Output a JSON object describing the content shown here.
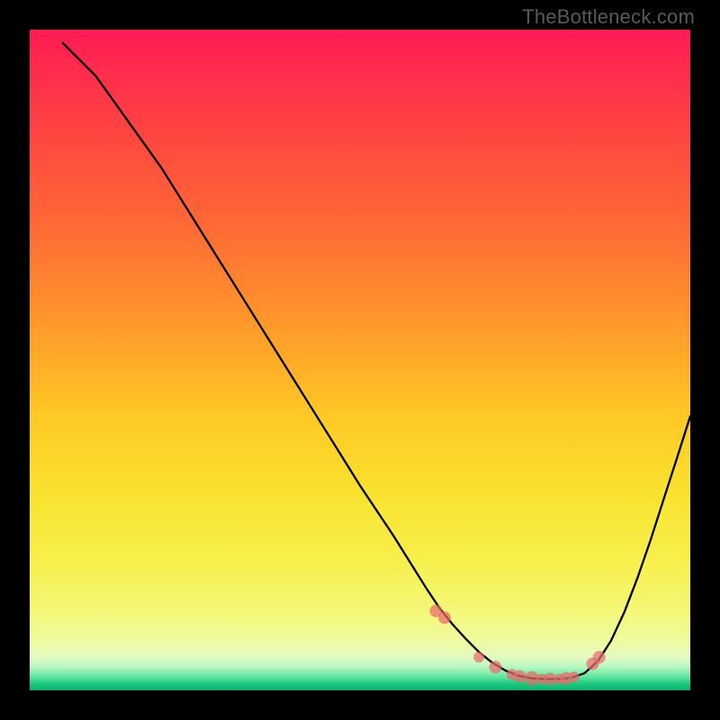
{
  "watermark": "TheBottleneck.com",
  "chart_data": {
    "type": "line",
    "title": "",
    "xlabel": "",
    "ylabel": "",
    "xlim": [
      0,
      100
    ],
    "ylim": [
      0,
      100
    ],
    "series": [
      {
        "name": "bottleneck-curve",
        "x": [
          5,
          10,
          15,
          20,
          25,
          30,
          35,
          40,
          45,
          50,
          55,
          60,
          62,
          64,
          66,
          68,
          70,
          72,
          74,
          76,
          78,
          80,
          82,
          84,
          86,
          88,
          90,
          92,
          94,
          96,
          98,
          100
        ],
        "y": [
          98,
          93,
          86,
          79,
          71,
          63,
          55,
          47,
          39,
          31,
          23.5,
          15.5,
          12.5,
          10,
          7.8,
          5.8,
          4.2,
          3.0,
          2.2,
          1.8,
          1.7,
          1.7,
          1.9,
          2.6,
          4.4,
          7.5,
          11.8,
          17.0,
          22.8,
          29.0,
          35.2,
          41.5
        ]
      }
    ],
    "points": {
      "name": "highlight-dots",
      "x": [
        61.5,
        62.8,
        68.0,
        70.5,
        73.0,
        74.2,
        76.0,
        77.5,
        78.8,
        80.2,
        81.2,
        82.4,
        85.2,
        86.2
      ],
      "y": [
        12.0,
        11.0,
        5.0,
        3.5,
        2.4,
        2.1,
        1.8,
        1.7,
        1.7,
        1.7,
        1.8,
        2.0,
        4.0,
        5.0
      ],
      "r": [
        7,
        7,
        6,
        7,
        6,
        7,
        8,
        6,
        7,
        6,
        7,
        6,
        7,
        7
      ]
    }
  }
}
